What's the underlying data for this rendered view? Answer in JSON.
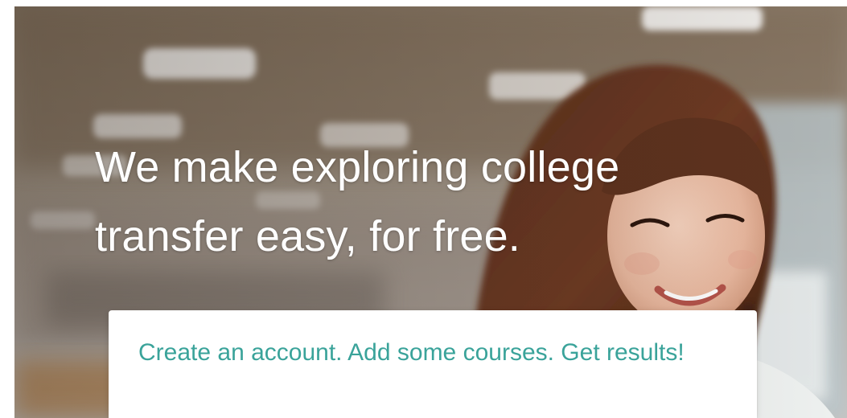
{
  "hero": {
    "headline": "We make exploring college transfer easy, for free.",
    "image": "woman-smiling-photo"
  },
  "card": {
    "text": "Create an account. Add some courses. Get results!"
  },
  "colors": {
    "headline": "#ffffff",
    "card_text": "#3aa39a",
    "card_background": "#ffffff"
  }
}
